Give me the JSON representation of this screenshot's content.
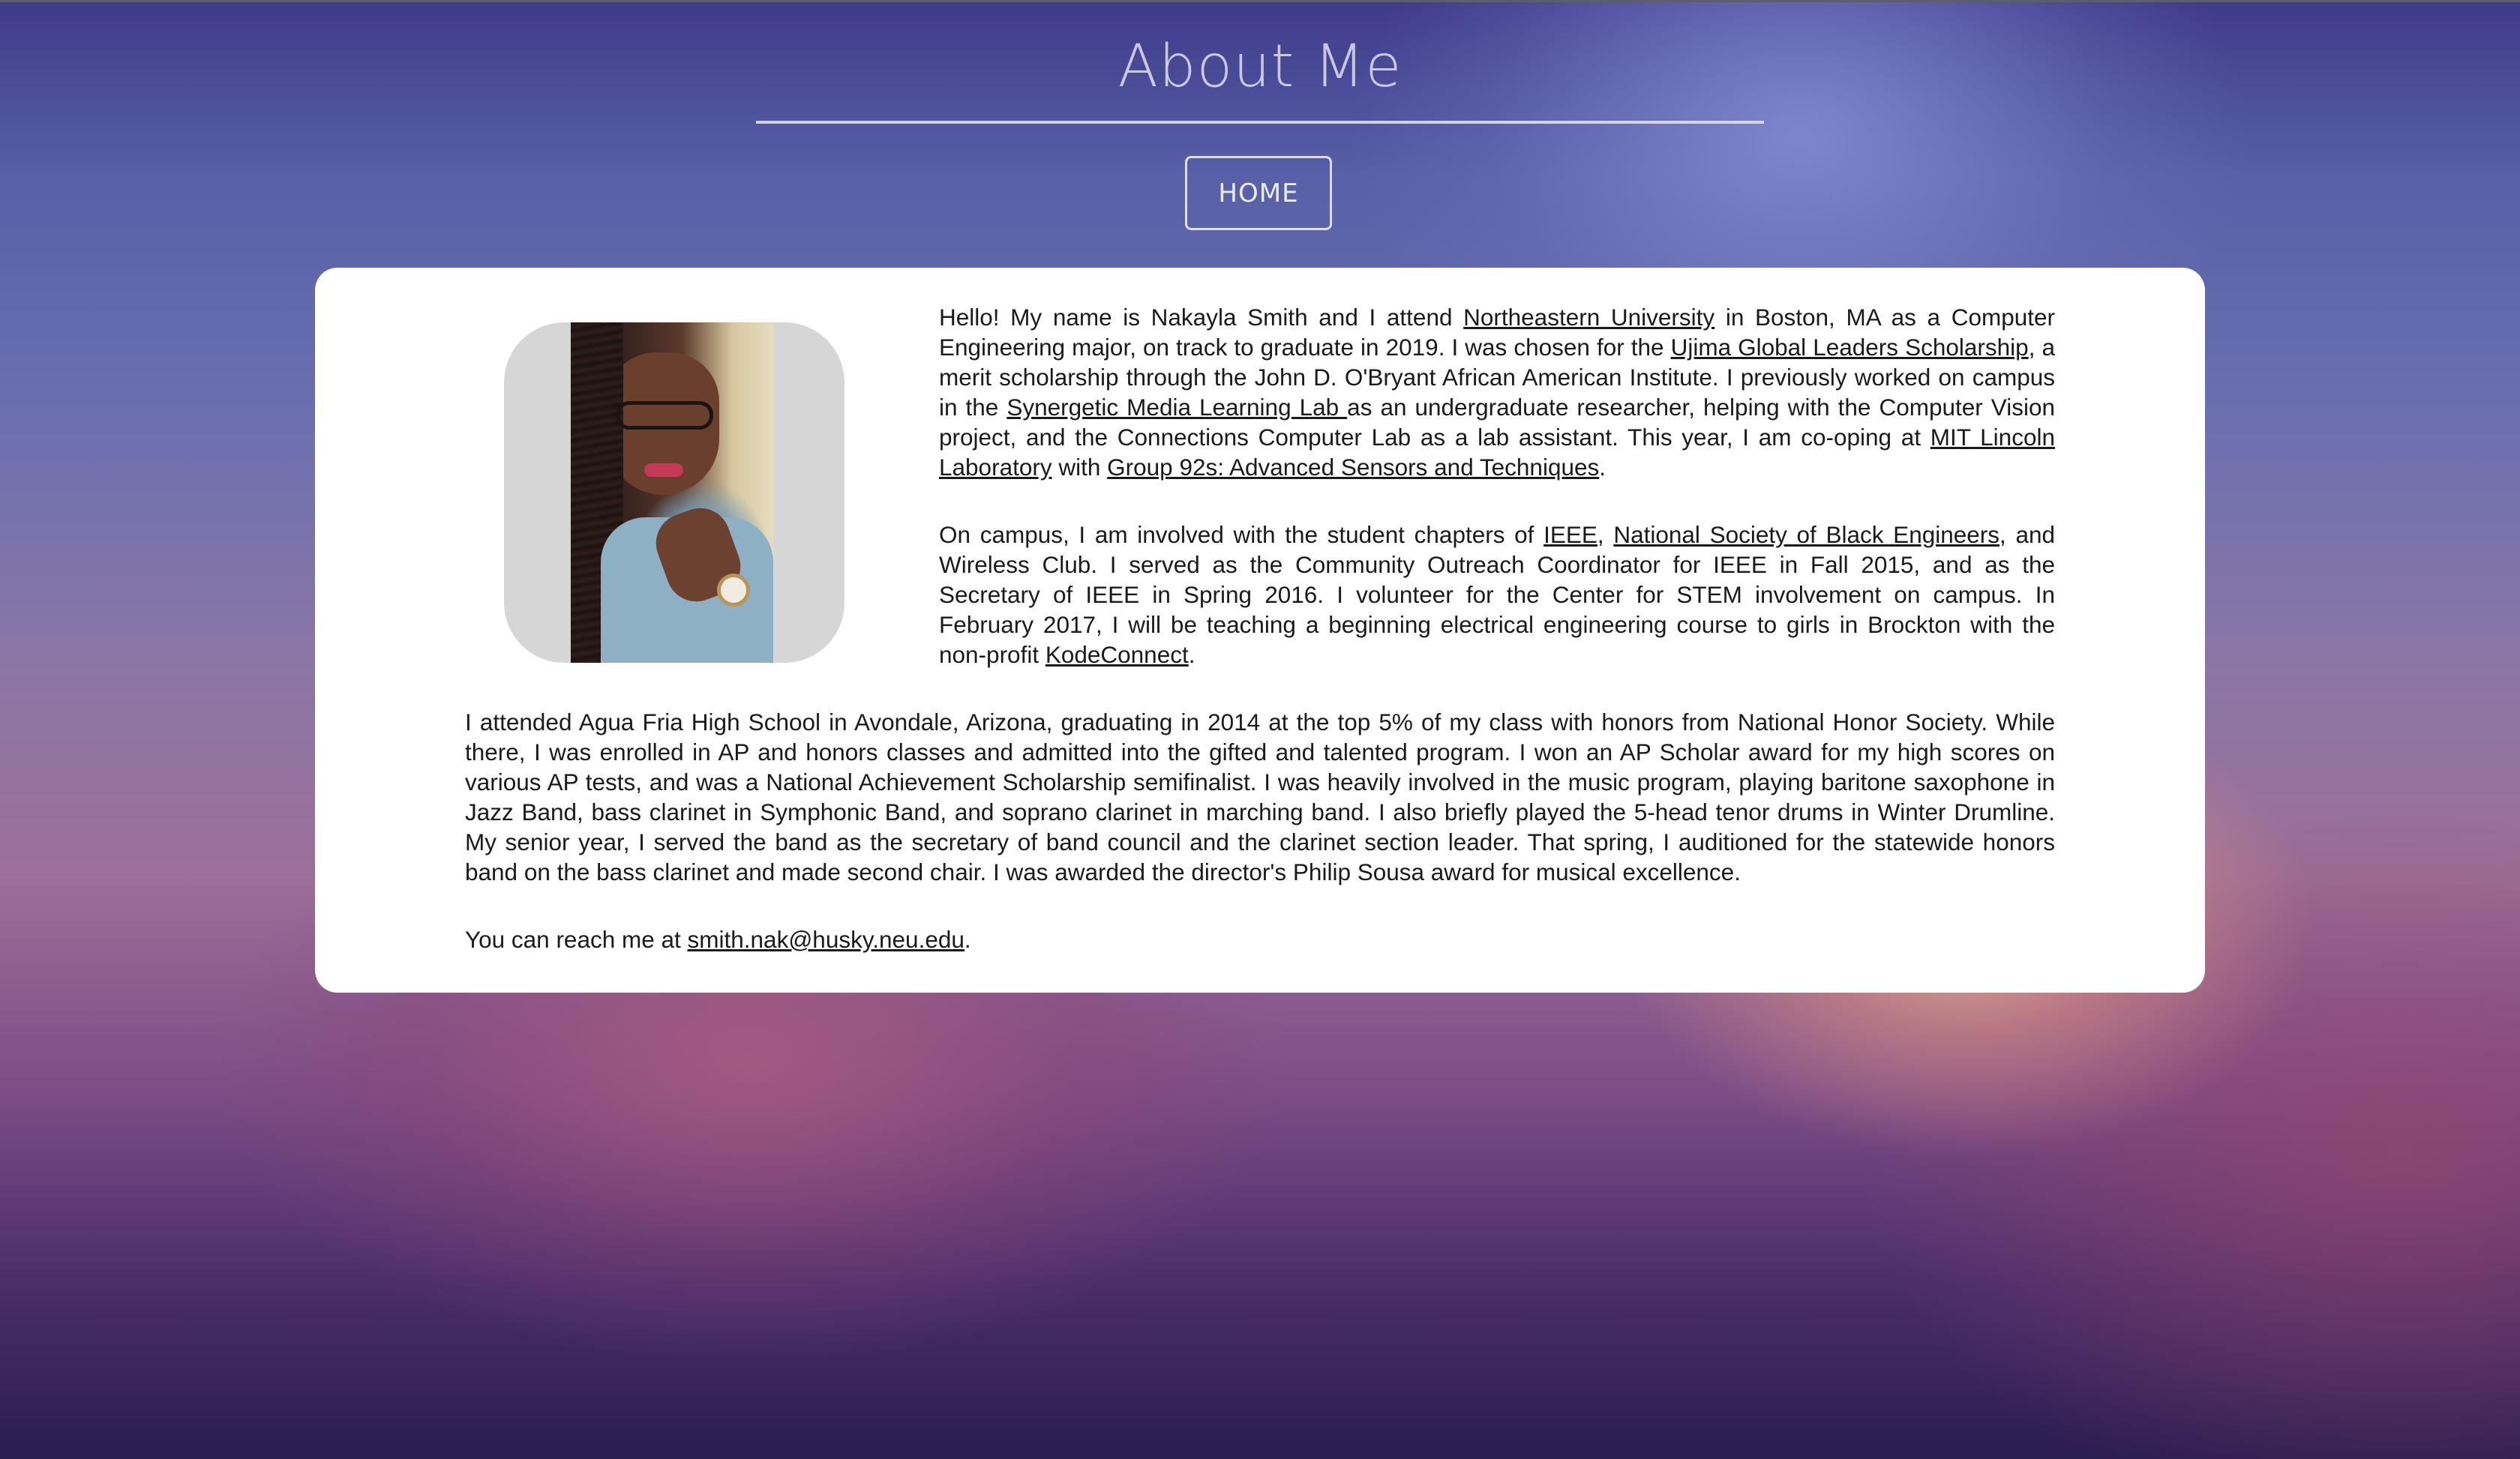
{
  "header": {
    "title": "About Me",
    "home_label": "HOME"
  },
  "profile": {
    "photo_alt": "profile-photo"
  },
  "bio": {
    "p1": {
      "t1": "Hello! My name is Nakayla Smith and I attend ",
      "link_neu": "Northeastern University",
      "t2": " in Boston, MA as a Computer Engineering major, on track to graduate in 2019. I was chosen for the ",
      "link_ujima": "Ujima Global Leaders Scholarship",
      "t3": ", a merit scholarship through the John D. O'Bryant African American Institute. I previously worked on campus in the ",
      "link_smlab": "Synergetic Media Learning Lab ",
      "t4": "as an undergraduate researcher, helping with the Computer Vision project, and the Connections Computer Lab as a lab assistant. This year, I am co-oping at ",
      "link_mitll": "MIT Lincoln Laboratory",
      "t5": " with ",
      "link_group": "Group 92s: Advanced Sensors and Techniques",
      "t6": "."
    },
    "p2": {
      "t1": "On campus, I am involved with the student chapters of ",
      "link_ieee": "IEEE",
      "t2": ", ",
      "link_nsbe": "National Society of Black Engineers",
      "t3": ", and Wireless Club. I served as the Community Outreach Coordinator for IEEE in Fall 2015, and as the Secretary of IEEE in Spring 2016. I volunteer for the Center for STEM involvement on campus. In February 2017, I will be teaching a beginning electrical engineering course to girls in Brockton with the non-profit ",
      "link_kode": "KodeConnect",
      "t4": "."
    },
    "p3": "I attended Agua Fria High School in Avondale, Arizona, graduating in 2014 at the top 5% of my class with honors from National Honor Society. While there, I was enrolled in AP and honors classes and admitted into the gifted and talented program. I won an AP Scholar award for my high scores on various AP tests, and was a National Achievement Scholarship semifinalist. I was heavily involved in the music program, playing baritone saxophone in Jazz Band, bass clarinet in Symphonic Band, and soprano clarinet in marching band. I also briefly played the 5-head tenor drums in Winter Drumline. My senior year, I served the band as the secretary of band council and the clarinet section leader. That spring, I auditioned for the statewide honors band on the bass clarinet and made second chair. I was awarded the director's Philip Sousa award for musical excellence.",
    "p4": {
      "t1": "You can reach me at ",
      "link_email": "smith.nak@husky.neu.edu",
      "t2": "."
    }
  },
  "colors": {
    "card": "#ffffff",
    "text": "#1a1a1a",
    "header_text": "#e6e4f4"
  }
}
